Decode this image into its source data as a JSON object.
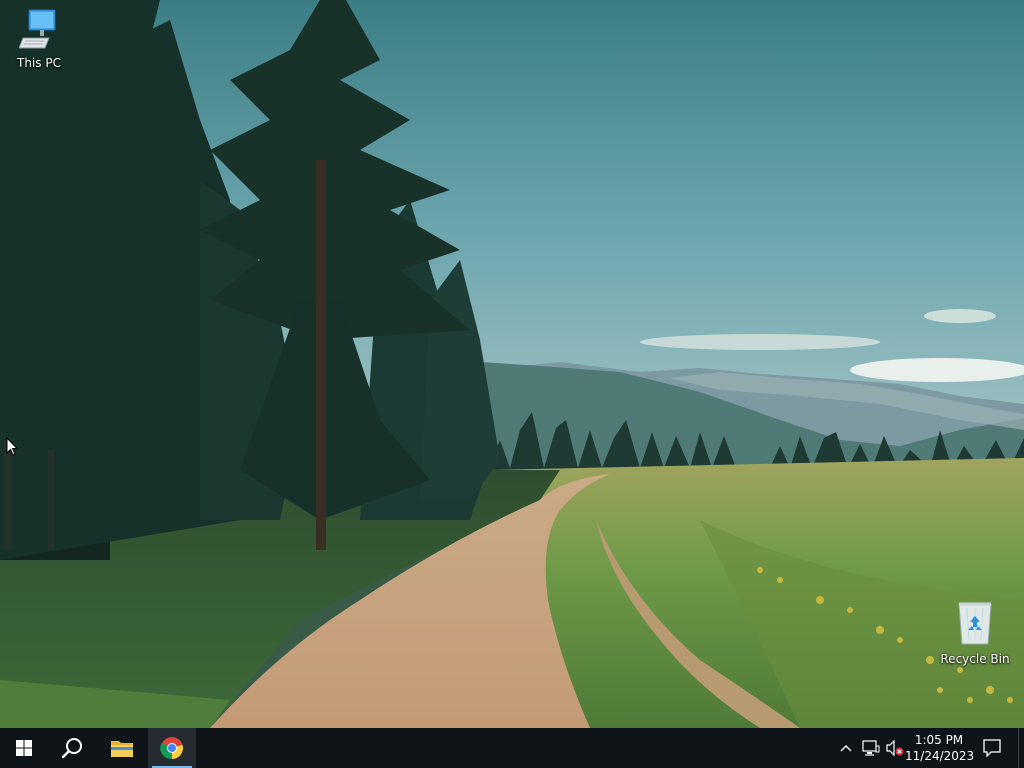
{
  "desktop": {
    "icons": [
      {
        "label": "This PC",
        "icon": "computer-icon"
      },
      {
        "label": "Recycle Bin",
        "icon": "recycle-bin-icon"
      }
    ]
  },
  "taskbar": {
    "start_icon": "windows-logo-icon",
    "search_icon": "search-icon",
    "pinned": [
      {
        "app": "File Explorer",
        "icon": "folder-icon",
        "active": false
      },
      {
        "app": "Google Chrome",
        "icon": "chrome-icon",
        "active": true
      }
    ],
    "tray": {
      "chevron_icon": "chevron-up-icon",
      "network_icon": "network-icon",
      "volume_icon": "volume-muted-icon"
    },
    "clock": {
      "time": "1:05 PM",
      "date": "11/24/2023"
    },
    "notification_icon": "notification-icon"
  },
  "colors": {
    "taskbar": "#0f1418",
    "active_indicator": "#76b9ed",
    "sky": "#4a8a92",
    "grass": "#7a9a44",
    "path": "#c4a078"
  }
}
